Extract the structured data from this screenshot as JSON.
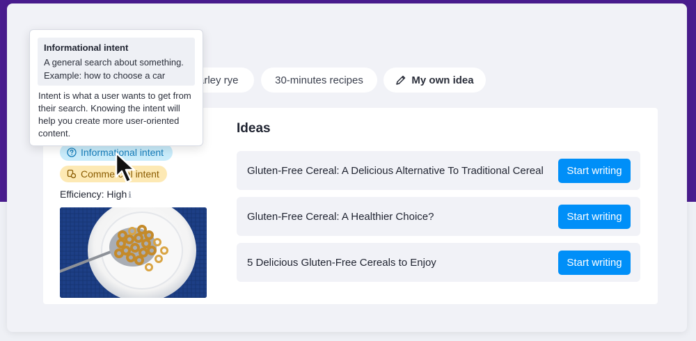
{
  "colors": {
    "background_top": "#4a1d8f",
    "accent_button": "#008ff8",
    "informational_badge_bg": "#c9ecfb",
    "informational_badge_text": "#147dbb",
    "commercial_badge_bg": "#fde9b4",
    "commercial_badge_text": "#8a5b00"
  },
  "chips": [
    {
      "label": "arley rye"
    },
    {
      "label": "30-minutes recipes"
    },
    {
      "label": "My own idea",
      "icon": "pencil-icon"
    }
  ],
  "tooltip": {
    "title": "Informational intent",
    "line1": "A general search about something.",
    "line2": "Example: how to choose a car",
    "body": "Intent is what a user wants to get from their search. Knowing the intent will help you create more user-oriented content."
  },
  "intents": {
    "informational": {
      "label": "Informational intent",
      "icon": "question-circle-icon"
    },
    "commercial": {
      "label": "Commercial intent",
      "icon": "coins-icon"
    }
  },
  "efficiency": {
    "label": "Efficiency: High",
    "info_icon": "info-icon"
  },
  "photo": {
    "icon": "cereal-bowl-image"
  },
  "ideas": {
    "title": "Ideas",
    "items": [
      {
        "text": "Gluten-Free Cereal: A Delicious Alternative To Traditional Cereal",
        "button": "Start writing"
      },
      {
        "text": "Gluten-Free Cereal: A Healthier Choice?",
        "button": "Start writing"
      },
      {
        "text": "5 Delicious Gluten-Free Cereals to Enjoy",
        "button": "Start writing"
      }
    ]
  }
}
